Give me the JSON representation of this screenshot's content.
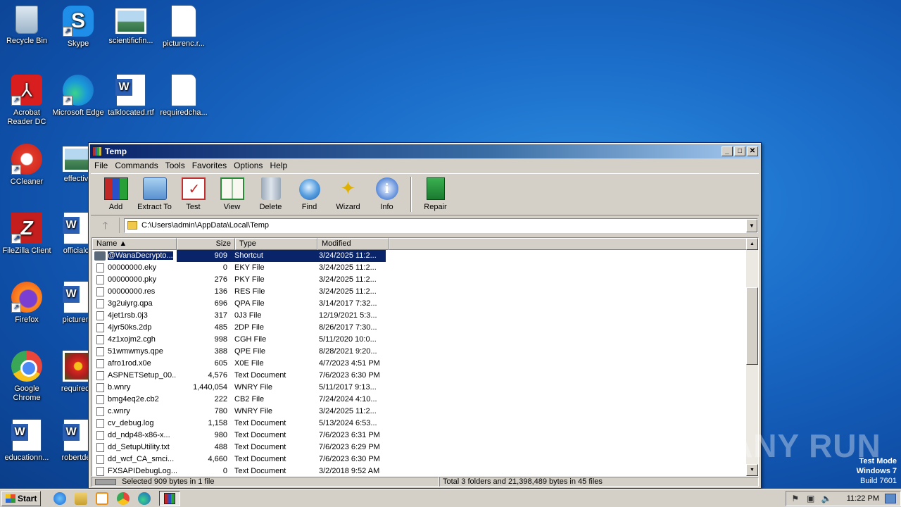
{
  "desktop": {
    "icons": [
      {
        "label": "Recycle Bin"
      },
      {
        "label": "Skype"
      },
      {
        "label": "scientificfin..."
      },
      {
        "label": "picturenc.r..."
      },
      {
        "label": "Acrobat Reader DC"
      },
      {
        "label": "Microsoft Edge"
      },
      {
        "label": "talklocated.rtf"
      },
      {
        "label": "requiredcha..."
      },
      {
        "label": "CCleaner"
      },
      {
        "label": "effective"
      },
      {
        "label": "FileZilla Client"
      },
      {
        "label": "officialco"
      },
      {
        "label": "Firefox"
      },
      {
        "label": "picturenc"
      },
      {
        "label": "Google Chrome"
      },
      {
        "label": "requiredcl"
      },
      {
        "label": "educationn..."
      },
      {
        "label": "robertdep"
      }
    ]
  },
  "window": {
    "title": "Temp",
    "menu": [
      "File",
      "Commands",
      "Tools",
      "Favorites",
      "Options",
      "Help"
    ],
    "toolbar": [
      "Add",
      "Extract To",
      "Test",
      "View",
      "Delete",
      "Find",
      "Wizard",
      "Info",
      "Repair"
    ],
    "address": "C:\\Users\\admin\\AppData\\Local\\Temp",
    "columns": {
      "name": "Name",
      "size": "Size",
      "type": "Type",
      "modified": "Modified"
    },
    "files": [
      {
        "name": "@WanaDecrypto...",
        "size": "909",
        "type": "Shortcut",
        "modified": "3/24/2025 11:2...",
        "selected": true,
        "icon": "shortcut-icon"
      },
      {
        "name": "00000000.eky",
        "size": "0",
        "type": "EKY File",
        "modified": "3/24/2025 11:2..."
      },
      {
        "name": "00000000.pky",
        "size": "276",
        "type": "PKY File",
        "modified": "3/24/2025 11:2..."
      },
      {
        "name": "00000000.res",
        "size": "136",
        "type": "RES File",
        "modified": "3/24/2025 11:2..."
      },
      {
        "name": "3g2uiyrg.qpa",
        "size": "696",
        "type": "QPA File",
        "modified": "3/14/2017 7:32..."
      },
      {
        "name": "4jet1rsb.0j3",
        "size": "317",
        "type": "0J3 File",
        "modified": "12/19/2021 5:3..."
      },
      {
        "name": "4jyr50ks.2dp",
        "size": "485",
        "type": "2DP File",
        "modified": "8/26/2017 7:30..."
      },
      {
        "name": "4z1xojm2.cgh",
        "size": "998",
        "type": "CGH File",
        "modified": "5/11/2020 10:0..."
      },
      {
        "name": "51wmwmys.qpe",
        "size": "388",
        "type": "QPE File",
        "modified": "8/28/2021 9:20..."
      },
      {
        "name": "afro1rod.x0e",
        "size": "605",
        "type": "X0E File",
        "modified": "4/7/2023 4:51 PM"
      },
      {
        "name": "ASPNETSetup_00...",
        "size": "4,576",
        "type": "Text Document",
        "modified": "7/6/2023 6:30 PM"
      },
      {
        "name": "b.wnry",
        "size": "1,440,054",
        "type": "WNRY File",
        "modified": "5/11/2017 9:13..."
      },
      {
        "name": "bmg4eq2e.cb2",
        "size": "222",
        "type": "CB2 File",
        "modified": "7/24/2024 4:10..."
      },
      {
        "name": "c.wnry",
        "size": "780",
        "type": "WNRY File",
        "modified": "3/24/2025 11:2..."
      },
      {
        "name": "cv_debug.log",
        "size": "1,158",
        "type": "Text Document",
        "modified": "5/13/2024 6:53..."
      },
      {
        "name": "dd_ndp48-x86-x...",
        "size": "980",
        "type": "Text Document",
        "modified": "7/6/2023 6:31 PM"
      },
      {
        "name": "dd_SetupUtility.txt",
        "size": "488",
        "type": "Text Document",
        "modified": "7/6/2023 6:29 PM"
      },
      {
        "name": "dd_wcf_CA_smci...",
        "size": "4,660",
        "type": "Text Document",
        "modified": "7/6/2023 6:30 PM"
      },
      {
        "name": "FXSAPIDebugLog...",
        "size": "0",
        "type": "Text Document",
        "modified": "3/2/2018 9:52 AM"
      }
    ],
    "status_left": "Selected 909 bytes in 1 file",
    "status_right": "Total 3 folders and 21,398,489 bytes in 45 files"
  },
  "taskbar": {
    "start": "Start",
    "time": "11:22 PM"
  },
  "watermark": "ANY RUN",
  "test_mode": {
    "line1": "Test Mode",
    "line2": "Windows 7",
    "line3": "Build 7601"
  }
}
